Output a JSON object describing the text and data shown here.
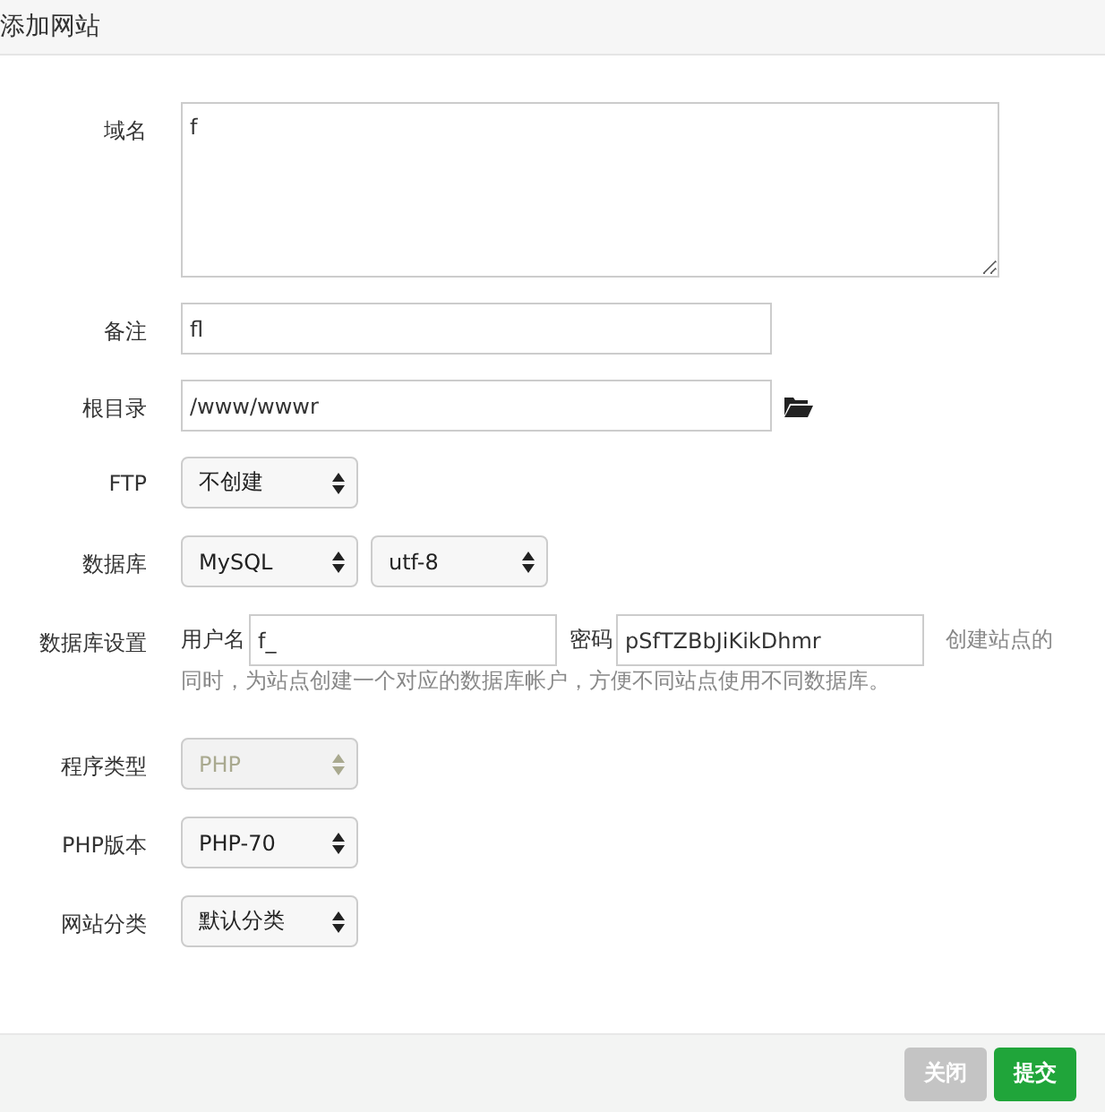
{
  "window": {
    "title": "添加网站"
  },
  "rows": [
    {
      "kind": "textarea",
      "label": "域名",
      "value": "f"
    },
    {
      "kind": "input",
      "label": "备注",
      "value": "fl"
    },
    {
      "kind": "folder",
      "label": "根目录",
      "value": "/www/wwwr"
    },
    {
      "kind": "select",
      "label": "FTP",
      "selects": [
        {
          "value": "不创建",
          "disabled": false
        }
      ]
    },
    {
      "kind": "select",
      "label": "数据库",
      "selects": [
        {
          "value": "MySQL",
          "disabled": false
        },
        {
          "value": "utf-8",
          "disabled": false
        }
      ]
    },
    {
      "kind": "db",
      "label": "数据库设置",
      "user_label": "用户名",
      "user": "f_",
      "pass_label": "密码",
      "pass": "pSfTZBbJiKikDhmr",
      "hint_lines": [
        "创建站点的",
        "同时，为站点创建一个对应的数据库帐户，方便不同站点使用不同数据库。"
      ]
    },
    {
      "kind": "select",
      "label": "程序类型",
      "selects": [
        {
          "value": "PHP",
          "disabled": true
        }
      ]
    },
    {
      "kind": "select",
      "label": "PHP版本",
      "selects": [
        {
          "value": "PHP-70",
          "disabled": false
        }
      ]
    },
    {
      "kind": "select",
      "label": "网站分类",
      "selects": [
        {
          "value": "默认分类",
          "disabled": false
        }
      ]
    }
  ],
  "buttons": [
    {
      "label": "关闭",
      "kind": "close"
    },
    {
      "label": "提交",
      "kind": "submit"
    }
  ]
}
